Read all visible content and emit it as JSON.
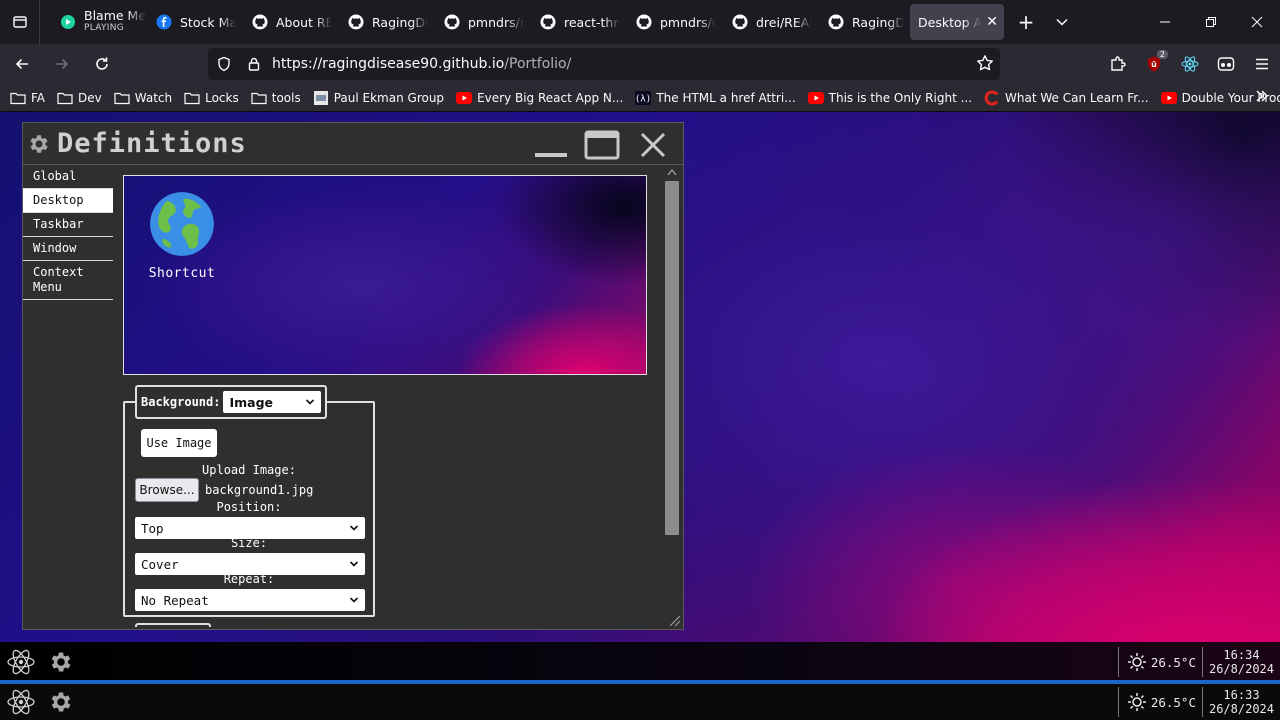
{
  "browser": {
    "tabs": [
      {
        "title": "Blame Me",
        "subtitle": "PLAYING",
        "icon": "media-icon"
      },
      {
        "title": "Stock Mar",
        "icon": "facebook-icon"
      },
      {
        "title": "About REA",
        "icon": "github-icon"
      },
      {
        "title": "RagingDis",
        "icon": "github-icon"
      },
      {
        "title": "pmndrs/re",
        "icon": "github-icon"
      },
      {
        "title": "react-three",
        "icon": "github-icon"
      },
      {
        "title": "pmndrs/d",
        "icon": "github-icon"
      },
      {
        "title": "drei/READ",
        "icon": "github-icon"
      },
      {
        "title": "RagingDis",
        "icon": "github-icon"
      },
      {
        "title": "Desktop Ap",
        "icon": "none",
        "active": true
      }
    ],
    "url_host": "https://ragingdisease90.github.io",
    "url_path": "/Portfolio/",
    "extension_badge": "2",
    "bookmarks": [
      {
        "label": "FA",
        "icon": "folder-icon"
      },
      {
        "label": "Dev",
        "icon": "folder-icon"
      },
      {
        "label": "Watch",
        "icon": "folder-icon"
      },
      {
        "label": "Locks",
        "icon": "folder-icon"
      },
      {
        "label": "tools",
        "icon": "folder-icon"
      },
      {
        "label": "Paul Ekman Group",
        "icon": "peg-icon"
      },
      {
        "label": "Every Big React App N...",
        "icon": "youtube-icon"
      },
      {
        "label": "The HTML a href Attri...",
        "icon": "fcc-icon"
      },
      {
        "label": "This is the Only Right ...",
        "icon": "youtube-icon"
      },
      {
        "label": "What We Can Learn Fr...",
        "icon": "red-c-icon"
      },
      {
        "label": "Double Your Productiv...",
        "icon": "youtube-icon"
      }
    ]
  },
  "window": {
    "title": "Definitions",
    "sidebar": [
      "Global",
      "Desktop",
      "Taskbar",
      "Window",
      "Context Menu"
    ],
    "selected": "Desktop",
    "shortcut_label": "Shortcut",
    "background_label": "Background:",
    "background_value": "Image",
    "use_image_label": "Use Image",
    "upload_label": "Upload Image:",
    "browse_label": "Browse...",
    "file_name": "background1.jpg",
    "position_label": "Position:",
    "position_value": "Top",
    "size_label": "Size:",
    "size_value": "Cover",
    "repeat_label": "Repeat:",
    "repeat_value": "No Repeat"
  },
  "taskbars": [
    {
      "temp": "26.5°C",
      "time": "16:34",
      "date": "26/8/2024"
    },
    {
      "temp": "26.5°C",
      "time": "16:33",
      "date": "26/8/2024"
    }
  ],
  "colors": {
    "accent_blue": "#1d66c8",
    "wallpaper_pink": "#e0006e",
    "wallpaper_purple": "#3c1a9a"
  }
}
